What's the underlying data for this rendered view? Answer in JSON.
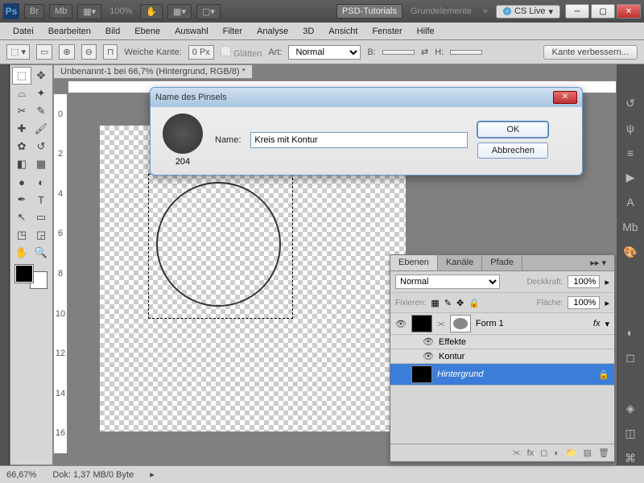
{
  "topbar": {
    "zoom": "100%",
    "workspace1": "PSD-Tutorials",
    "workspace2": "Grundelemente",
    "cslive": "CS Live"
  },
  "menu": [
    "Datei",
    "Bearbeiten",
    "Bild",
    "Ebene",
    "Auswahl",
    "Filter",
    "Analyse",
    "3D",
    "Ansicht",
    "Fenster",
    "Hilfe"
  ],
  "options": {
    "weiche_kante_lbl": "Weiche Kante:",
    "weiche_kante_val": "0 Px",
    "glaetten": "Glätten",
    "art_lbl": "Art:",
    "art_val": "Normal",
    "b_lbl": "B:",
    "h_lbl": "H:",
    "refine": "Kante verbessern..."
  },
  "doc": {
    "tab": "Unbenannt-1 bei 66,7% (Hintergrund, RGB/8) *"
  },
  "ruler_v": [
    "0",
    "2",
    "4",
    "6",
    "8",
    "10",
    "12",
    "14",
    "16"
  ],
  "dialog": {
    "title": "Name des Pinsels",
    "preview_size": "204",
    "name_label": "Name:",
    "name_value": "Kreis mit Kontur",
    "ok": "OK",
    "cancel": "Abbrechen"
  },
  "layers": {
    "tabs": [
      "Ebenen",
      "Kanäle",
      "Pfade"
    ],
    "blend": "Normal",
    "opacity_lbl": "Deckkraft:",
    "opacity_val": "100%",
    "lock_lbl": "Fixieren:",
    "fill_lbl": "Fläche:",
    "fill_val": "100%",
    "items": [
      {
        "name": "Form 1",
        "fx": "fx"
      },
      {
        "name": "Effekte"
      },
      {
        "name": "Kontur"
      },
      {
        "name": "Hintergrund"
      }
    ]
  },
  "status": {
    "zoom": "66,67%",
    "doc": "Dok: 1,37 MB/0 Byte"
  }
}
